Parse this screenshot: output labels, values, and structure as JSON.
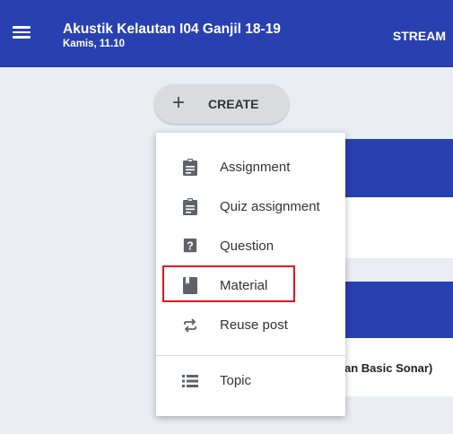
{
  "header": {
    "class_title": "Akustik Kelautan I04 Ganjil 18-19",
    "class_subtitle": "Kamis, 11.10",
    "stream_tab": "STREAM",
    "menu_icon": "hamburger-menu-icon"
  },
  "create_button": {
    "icon": "plus-icon",
    "label": "CREATE"
  },
  "stream_card": {
    "partial_text": "an Basic Sonar)"
  },
  "create_menu": {
    "items": [
      {
        "label": "Assignment",
        "icon": "assignment-icon"
      },
      {
        "label": "Quiz assignment",
        "icon": "quiz-assignment-icon"
      },
      {
        "label": "Question",
        "icon": "question-icon"
      },
      {
        "label": "Material",
        "icon": "material-icon",
        "highlighted": true
      },
      {
        "label": "Reuse post",
        "icon": "reuse-post-icon"
      },
      {
        "label": "Topic",
        "icon": "topic-icon"
      }
    ]
  },
  "colors": {
    "header_bg": "#2840b0",
    "highlight_border": "#e0141e",
    "icon_color": "#5f6368"
  }
}
